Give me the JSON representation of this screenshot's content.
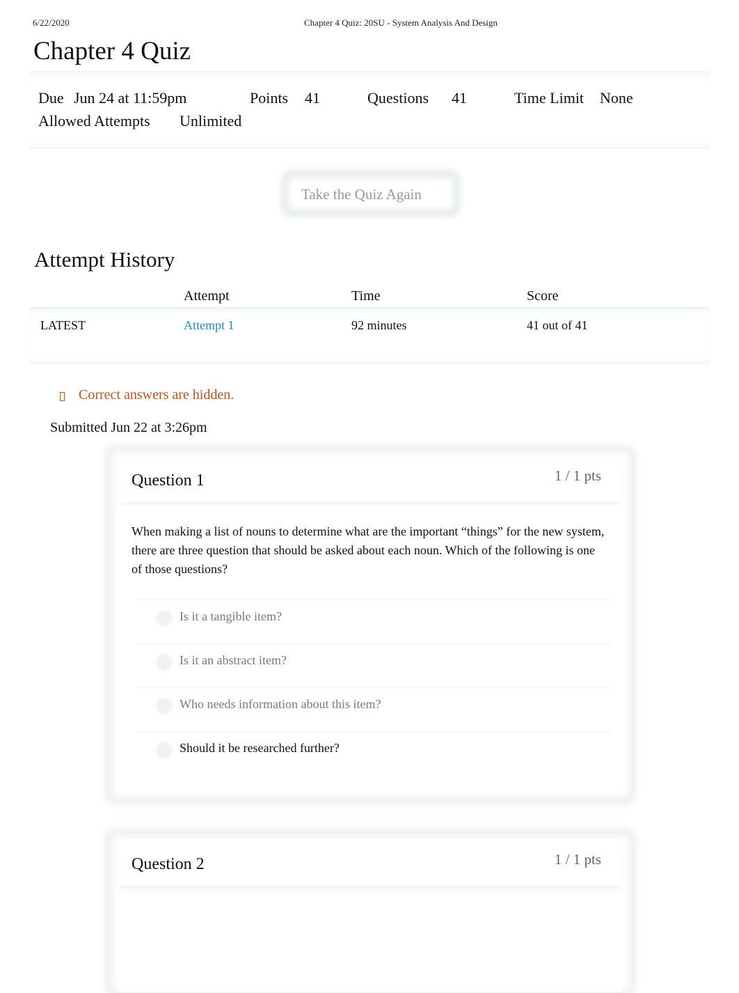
{
  "print_header": {
    "date": "6/22/2020",
    "title": "Chapter 4 Quiz: 20SU - System Analysis And Design"
  },
  "page_title": "Chapter 4 Quiz",
  "quiz_meta": {
    "due_label": "Due",
    "due_value": "Jun 24 at 11:59pm",
    "points_label": "Points",
    "points_value": "41",
    "questions_label": "Questions",
    "questions_value": "41",
    "time_limit_label": "Time Limit",
    "time_limit_value": "None",
    "allowed_attempts_label": "Allowed Attempts",
    "allowed_attempts_value": "Unlimited"
  },
  "take_quiz_button": "Take the Quiz Again",
  "attempt_history": {
    "title": "Attempt History",
    "columns": [
      "",
      "Attempt",
      "Time",
      "Score"
    ],
    "rows": [
      {
        "tag": "LATEST",
        "attempt": "Attempt 1",
        "time": "92 minutes",
        "score": "41 out of 41"
      }
    ]
  },
  "notice": {
    "icon": "warning-icon",
    "text": "Correct answers are hidden.",
    "color": "#c4511a"
  },
  "submitted": "Submitted Jun 22 at 3:26pm",
  "questions": [
    {
      "label": "Question 1",
      "points": "1 / 1 pts",
      "text": "When making a list of nouns to determine what are the important “things” for the new system, there are three question that should be asked about each noun. Which of the following is one of those questions?",
      "answers": [
        {
          "text": "Is it a tangible item?",
          "selected": false
        },
        {
          "text": "Is it an abstract item?",
          "selected": false
        },
        {
          "text": "Who needs information about this item?",
          "selected": false
        },
        {
          "text": "Should it be researched further?",
          "selected": true
        }
      ]
    },
    {
      "label": "Question 2",
      "points": "1 / 1 pts"
    }
  ],
  "colors": {
    "link": "#1a8cd8",
    "notice": "#c4511a",
    "muted_answer": "#7a7a7a"
  }
}
